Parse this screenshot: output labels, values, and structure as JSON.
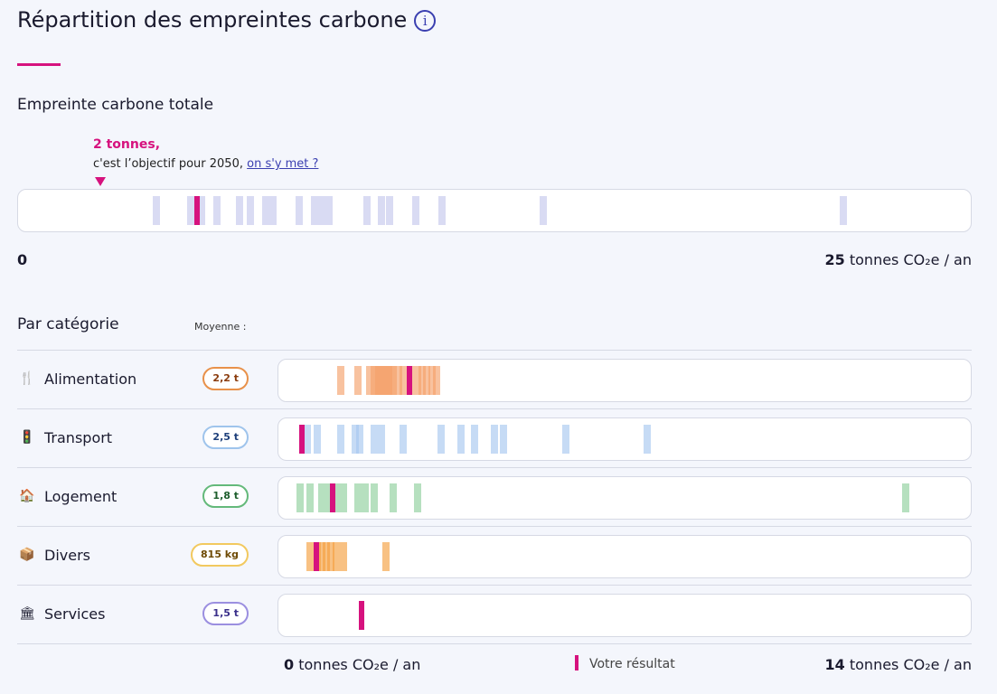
{
  "header": {
    "title": "Répartition des empreintes carbone",
    "info_icon": "info-icon"
  },
  "total": {
    "section_title": "Empreinte carbone totale",
    "goal_value": "2 tonnes,",
    "goal_text": "c'est l’objectif pour 2050,",
    "goal_link": "on s'y met ?",
    "scale_min": "0",
    "scale_max_value": "25",
    "scale_max_unit": "tonnes CO₂e / an",
    "range": [
      0,
      25
    ],
    "goal": 2,
    "your_result": 4.5,
    "stripe_color": "#c5c7ec",
    "population": [
      3.4,
      4.3,
      4.6,
      5.0,
      5.6,
      5.9,
      6.3,
      6.5,
      7.2,
      7.6,
      7.8,
      8.0,
      9.0,
      9.4,
      9.6,
      10.3,
      11.0,
      13.7,
      21.7
    ]
  },
  "categories": {
    "section_title": "Par catégorie",
    "average_label": "Moyenne :",
    "range": [
      0,
      14
    ],
    "items": [
      {
        "label": "Alimentation",
        "icon": "fork-knife-icon",
        "glyph": "🍴",
        "average": "2,2 t",
        "badge_color": "#e8914a",
        "badge_text": "#8a3b0c",
        "stripe_color": "#f5a26b",
        "your_result": 2.45,
        "population": [
          1.0,
          1.35,
          1.6,
          1.7,
          1.75,
          1.8,
          1.85,
          1.9,
          1.95,
          2.0,
          2.05,
          2.1,
          2.2,
          2.3,
          2.45,
          2.6,
          2.7,
          2.8,
          2.9,
          3.0
        ]
      },
      {
        "label": "Transport",
        "icon": "traffic-light-icon",
        "glyph": "🚦",
        "average": "2,5 t",
        "badge_color": "#9fc4ec",
        "badge_text": "#1d3f7a",
        "stripe_color": "#a8c8f0",
        "your_result": 0.2,
        "population": [
          0.3,
          0.5,
          1.0,
          1.3,
          1.4,
          1.7,
          1.85,
          2.3,
          3.1,
          3.5,
          3.8,
          4.2,
          4.4,
          5.7,
          7.4
        ]
      },
      {
        "label": "Logement",
        "icon": "house-icon",
        "glyph": "🏠",
        "average": "1,8 t",
        "badge_color": "#64b97a",
        "badge_text": "#1d5e2c",
        "stripe_color": "#8fd09c",
        "your_result": 0.85,
        "population": [
          0.15,
          0.35,
          0.6,
          0.75,
          0.9,
          1.05,
          1.35,
          1.5,
          1.7,
          2.1,
          2.6,
          12.8
        ]
      },
      {
        "label": "Divers",
        "icon": "package-icon",
        "glyph": "📦",
        "average": "815 kg",
        "badge_color": "#f2c95f",
        "badge_text": "#6e4a05",
        "stripe_color": "#f5a040",
        "your_result": 0.5,
        "population": [
          0.35,
          0.5,
          0.6,
          0.7,
          0.8,
          0.9,
          1.05,
          1.95
        ]
      },
      {
        "label": "Services",
        "icon": "bank-icon",
        "glyph": "🏛",
        "average": "1,5 t",
        "badge_color": "#9b8fe0",
        "badge_text": "#3a2f8a",
        "stripe_color": "#c5c7ec",
        "your_result": 1.45,
        "population": []
      }
    ],
    "axis_min_value": "0",
    "axis_min_unit": "tonnes CO₂e / an",
    "axis_max_value": "14",
    "axis_max_unit": "tonnes CO₂e / an",
    "legend_label": "Votre résultat",
    "result_color": "#d6127e"
  }
}
